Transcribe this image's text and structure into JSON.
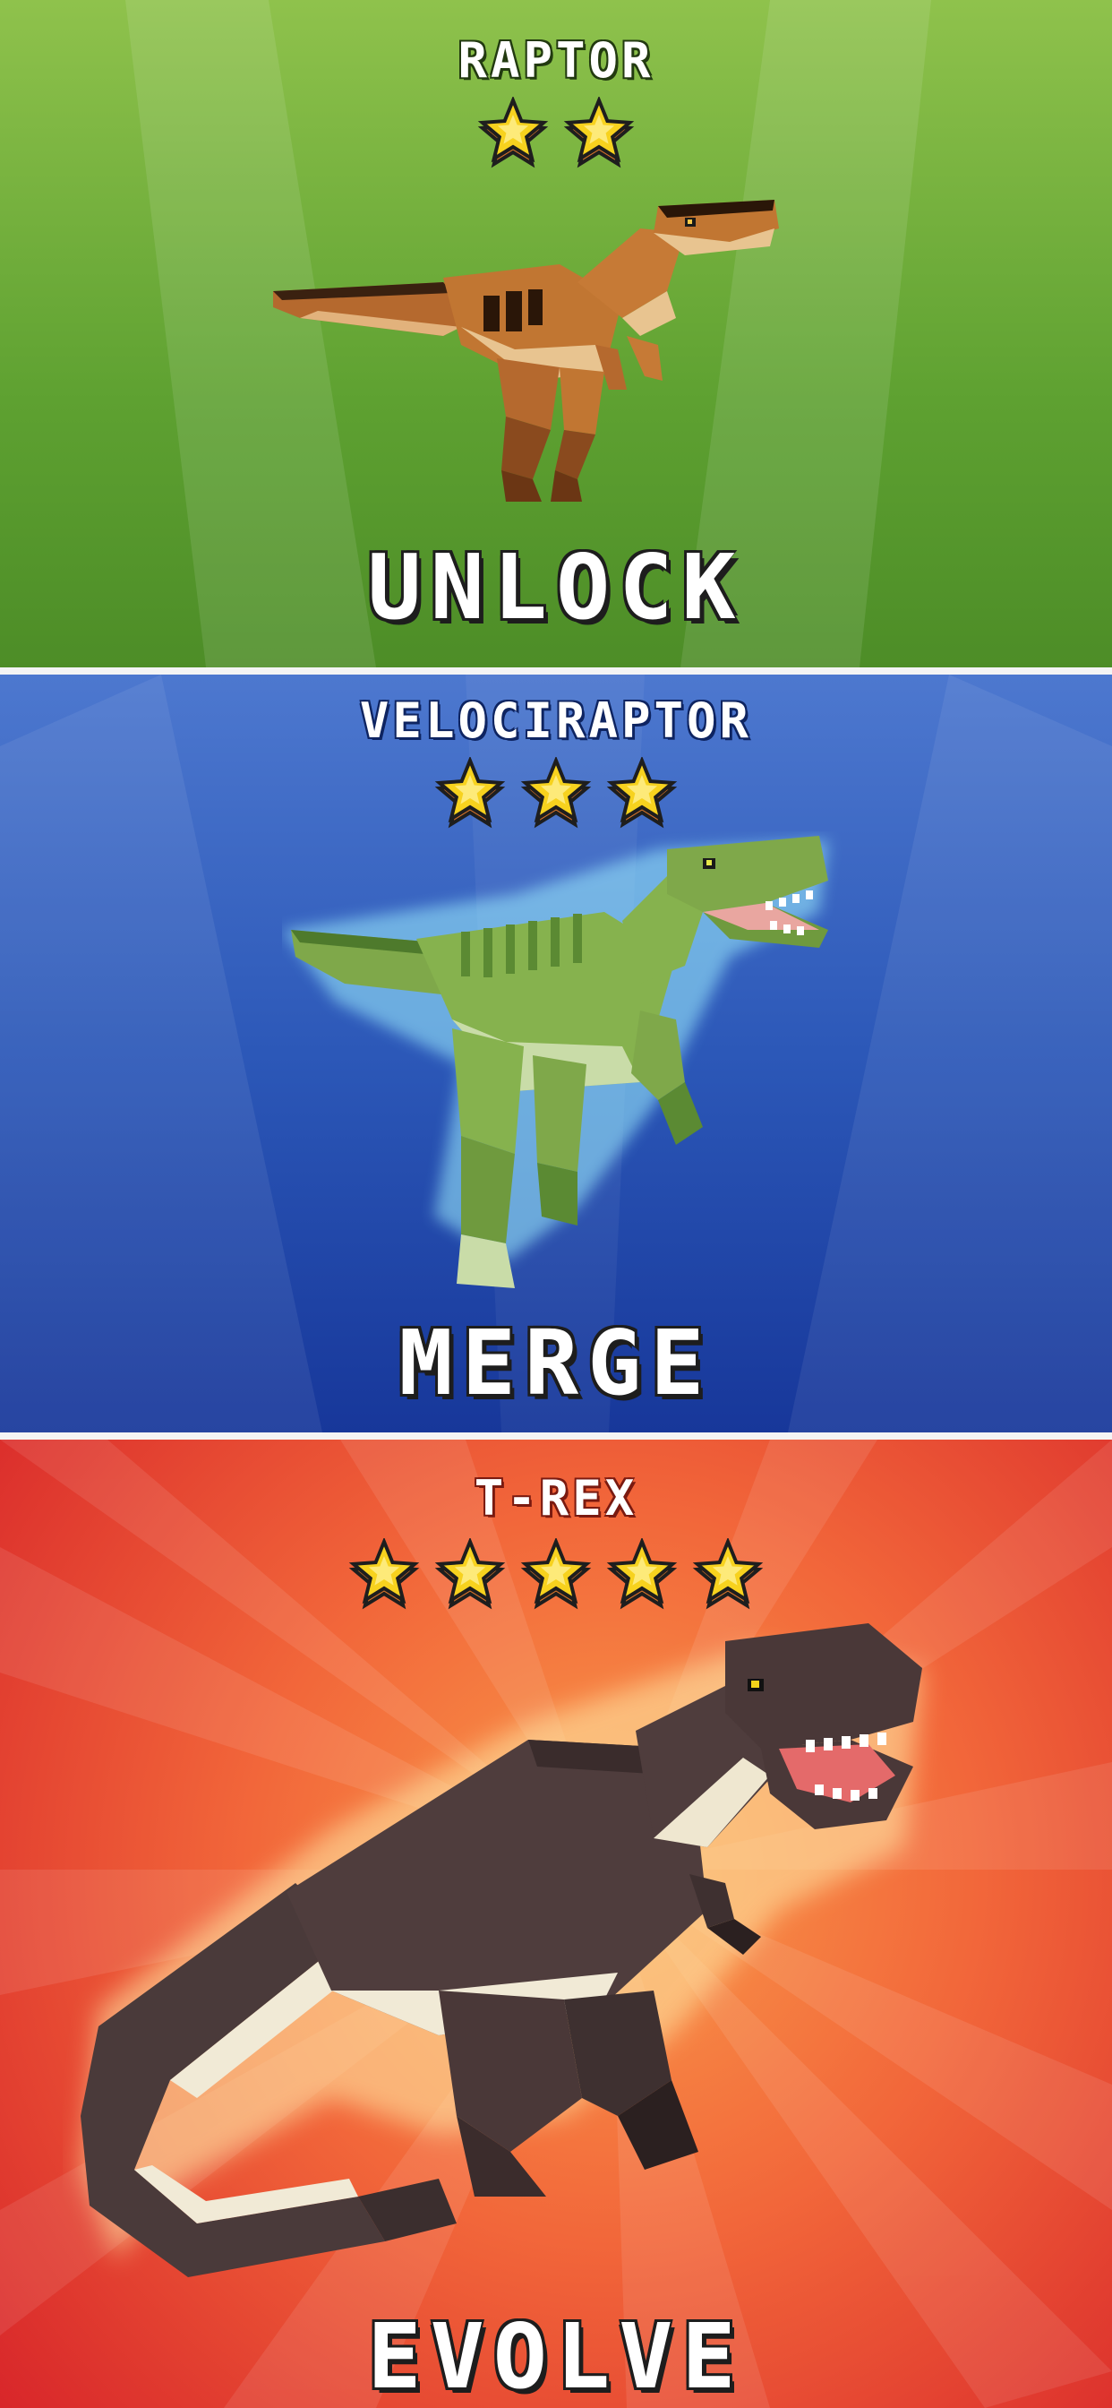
{
  "panels": [
    {
      "name": "RAPTOR",
      "stars": 2,
      "action": "UNLOCK",
      "colors": {
        "bg_top": "#8fc24c",
        "bg_bottom": "#4d8d27"
      }
    },
    {
      "name": "VELOCIRAPTOR",
      "stars": 3,
      "action": "MERGE",
      "colors": {
        "bg_top": "#4d78cf",
        "bg_bottom": "#17379a"
      }
    },
    {
      "name": "T-REX",
      "stars": 5,
      "action": "EVOLVE",
      "colors": {
        "bg_center": "#f99a4a",
        "bg_edge": "#d8262a"
      }
    }
  ],
  "star_color": "#f7d21e",
  "star_outline": "#1e1e1e"
}
